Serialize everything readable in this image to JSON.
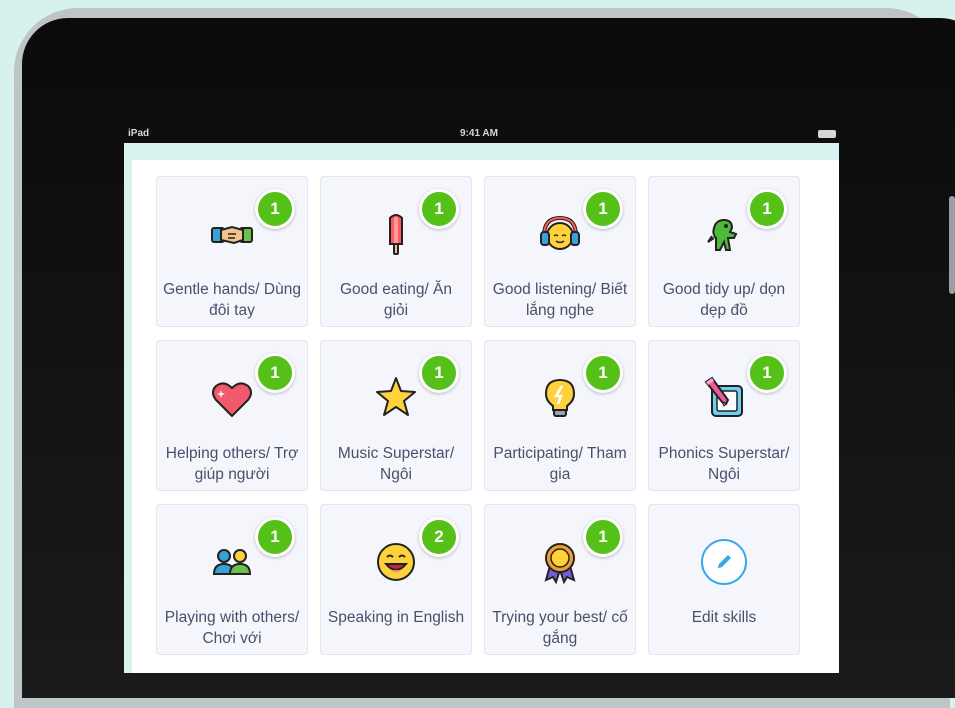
{
  "status_bar": {
    "carrier": "iPad",
    "time": "9:41 AM"
  },
  "skills": [
    {
      "label": "Gentle hands/ Dùng đôi tay",
      "count": "1",
      "icon": "handshake-icon"
    },
    {
      "label": "Good eating/ Ăn giỏi",
      "count": "1",
      "icon": "popsicle-icon"
    },
    {
      "label": "Good listening/ Biết lắng nghe",
      "count": "1",
      "icon": "headphones-icon"
    },
    {
      "label": "Good tidy up/ dọn dẹp đồ",
      "count": "1",
      "icon": "dinosaur-icon"
    },
    {
      "label": "Helping others/ Trợ giúp người",
      "count": "1",
      "icon": "heart-icon"
    },
    {
      "label": "Music Superstar/ Ngôi",
      "count": "1",
      "icon": "star-icon"
    },
    {
      "label": "Participating/ Tham gia",
      "count": "1",
      "icon": "lightbulb-icon"
    },
    {
      "label": "Phonics Superstar/ Ngôi",
      "count": "1",
      "icon": "pencil-paper-icon"
    },
    {
      "label": "Playing with others/ Chơi với",
      "count": "1",
      "icon": "people-icon"
    },
    {
      "label": "Speaking in English",
      "count": "2",
      "icon": "speaking-face-icon"
    },
    {
      "label": "Trying your best/ cố gắng",
      "count": "1",
      "icon": "medal-icon"
    }
  ],
  "edit_skills": {
    "label": "Edit skills",
    "icon": "pencil-icon"
  },
  "colors": {
    "badge": "#55c018",
    "tile_bg": "#f5f6fc",
    "label_text": "#4a4f6a",
    "edit_accent": "#3aa8e8"
  }
}
